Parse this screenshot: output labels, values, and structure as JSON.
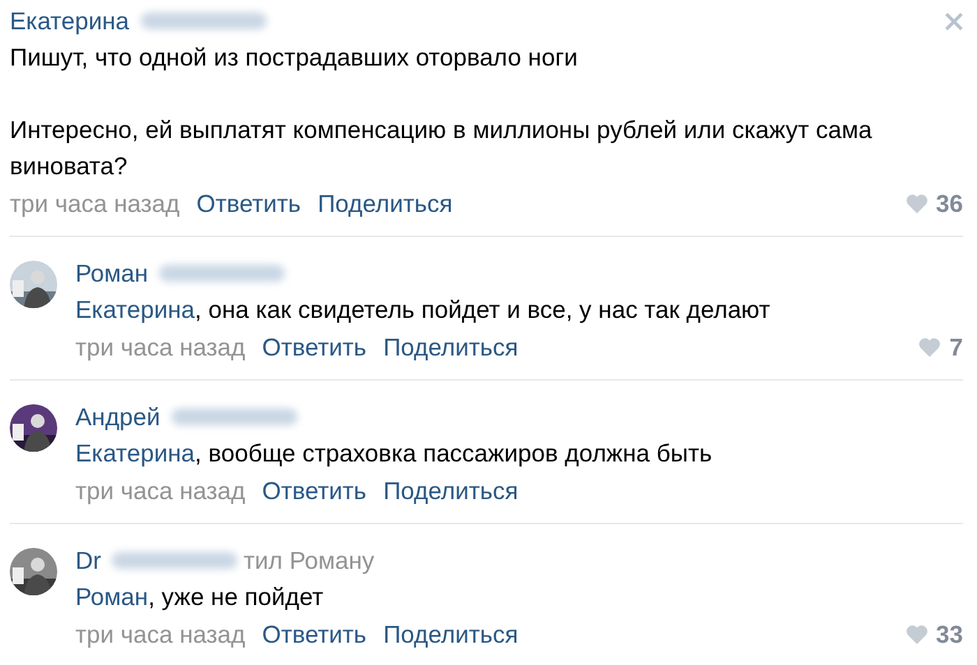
{
  "comments": [
    {
      "kind": "root",
      "author": "Екатерина",
      "surname_hidden": true,
      "paragraphs": [
        "Пишут, что одной из пострадавших оторвало ноги",
        "Интересно, ей выплатят компенсацию в миллионы рублей или скажут сама виновата?"
      ],
      "time": "три часа назад",
      "reply": "Ответить",
      "share": "Поделиться",
      "likes": "36"
    },
    {
      "kind": "reply",
      "author": "Роман",
      "surname_hidden": true,
      "mention": "Екатерина",
      "text": ", она как свидетель пойдет и все, у нас так делают",
      "time": "три часа назад",
      "reply": "Ответить",
      "share": "Поделиться",
      "likes": "7"
    },
    {
      "kind": "reply",
      "author": "Андрей",
      "surname_hidden": true,
      "mention": "Екатерина",
      "text": ", вообще страховка пассажиров должна быть",
      "time": "три часа назад",
      "reply": "Ответить",
      "share": "Поделиться"
    },
    {
      "kind": "reply",
      "author": "Dr",
      "surname_hidden": true,
      "reply_to": "тил Роману",
      "mention": "Роман",
      "text": ", уже не пойдет",
      "time": "три часа назад",
      "reply": "Ответить",
      "share": "Поделиться",
      "likes": "33"
    }
  ]
}
